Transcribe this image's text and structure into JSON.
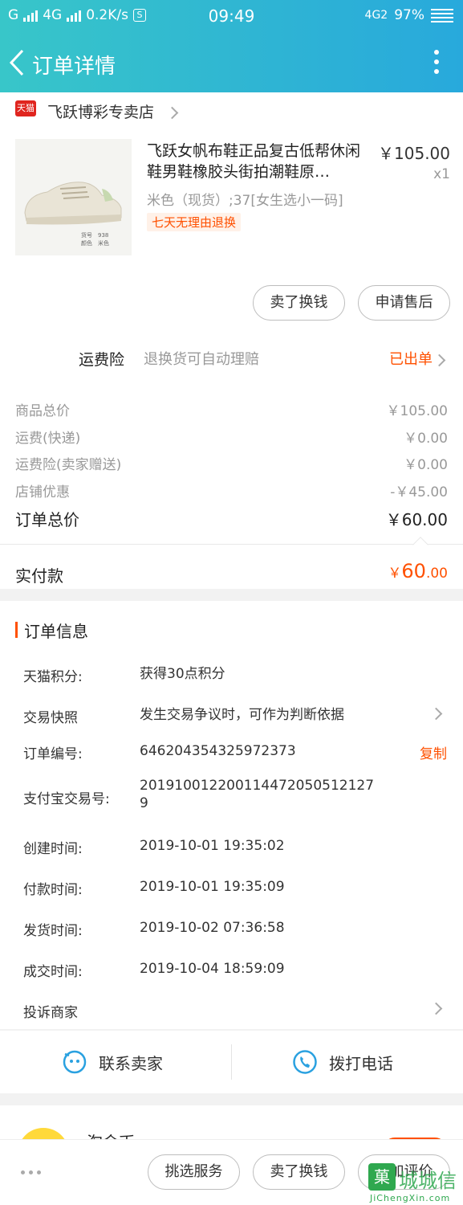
{
  "status_bar": {
    "carrier1": "G",
    "carrier2": "4G",
    "speed": "0.2K/s",
    "s_badge": "S",
    "time": "09:49",
    "net": "4G2",
    "battery": "97%"
  },
  "header": {
    "title": "订单详情"
  },
  "shop": {
    "badge": "天猫",
    "name": "飞跃博彩专卖店"
  },
  "product": {
    "title": "飞跃女帆布鞋正品复古低帮休闲鞋男鞋橡胶头街拍潮鞋原…",
    "price": "￥105.00",
    "qty": "x1",
    "sku": "米色（现货）;37[女生选小一码]",
    "tag": "七天无理由退换",
    "thumb_caption1": "货号　938",
    "thumb_caption2": "颜色　米色"
  },
  "actions": {
    "sell": "卖了换钱",
    "aftersale": "申请售后"
  },
  "insurance": {
    "label": "运费险",
    "desc": "退换货可自动理赔",
    "status": "已出单"
  },
  "fees": [
    {
      "label": "商品总价",
      "value": "￥105.00"
    },
    {
      "label": "运费(快递)",
      "value": "￥0.00"
    },
    {
      "label": "运费险(卖家赠送)",
      "value": "￥0.00"
    },
    {
      "label": "店铺优惠",
      "value": "-￥45.00"
    }
  ],
  "total": {
    "label": "订单总价",
    "value": "￥60.00"
  },
  "paid": {
    "label": "实付款",
    "currency": "￥",
    "integer": "60",
    "decimal": ".00"
  },
  "order_info": {
    "title": "订单信息",
    "rows": [
      {
        "label": "天猫积分:",
        "value": "获得30点积分"
      },
      {
        "label": "交易快照",
        "value": "发生交易争议时，可作为判断依据"
      },
      {
        "label": "订单编号:",
        "value": "646204354325972373",
        "action": "复制"
      },
      {
        "label": "支付宝交易号:",
        "value": "2019100122001144720505121279"
      },
      {
        "label": "创建时间:",
        "value": "2019-10-01 19:35:02"
      },
      {
        "label": "付款时间:",
        "value": "2019-10-01 19:35:09"
      },
      {
        "label": "发货时间:",
        "value": "2019-10-02 07:36:58"
      },
      {
        "label": "成交时间:",
        "value": "2019-10-04 18:59:09"
      },
      {
        "label": "投诉商家",
        "value": ""
      }
    ]
  },
  "contact": {
    "seller": "联系卖家",
    "phone": "拨打电话"
  },
  "bottom": {
    "partial_text": "淘金币",
    "buttons": [
      "挑选服务",
      "卖了换钱",
      "追加评价"
    ]
  },
  "watermark": {
    "logo": "菓",
    "cn": "城城信",
    "en": "JiChengXin.com"
  },
  "colors": {
    "accent": "#ff5000",
    "header_from": "#38c6c9",
    "header_to": "#28a9dc",
    "icon_blue": "#2aa1e0"
  }
}
